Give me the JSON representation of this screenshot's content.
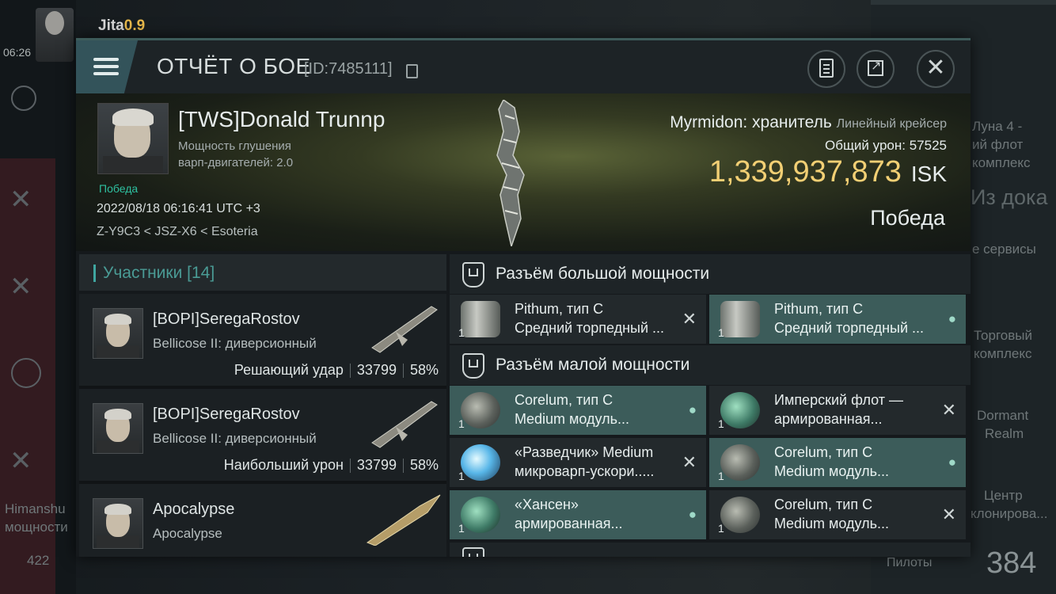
{
  "background": {
    "system": {
      "name": "Jita",
      "security": "0.9"
    },
    "clock": "06:26",
    "left_labels": [
      "Himanshu",
      "мощности"
    ],
    "bottom_count": "422",
    "right_labels": [
      "Луна 4 -",
      "ий флот",
      "комплекс",
      "Из дока",
      "е сервисы",
      "Торговый",
      "комплекс",
      "Dormant",
      "Realm",
      "Центр",
      "клонирова..."
    ],
    "pilots_label": "Пилоты",
    "pilots_count": "384"
  },
  "header": {
    "title": "ОТЧЁТ О БОЕ",
    "report_id": "[ID:7485111]"
  },
  "banner": {
    "pilot_name": "[TWS]Donald Trunnp",
    "pilot_attr_line1": "Мощность глушения",
    "pilot_attr_line2": "варп-двигателей: 2.0",
    "victory_tag": "Победа",
    "datetime": "2022/08/18 06:16:41 UTC +3",
    "route": "Z-Y9C3 < JSZ-X6 < Esoteria",
    "ship_name": "Myrmidon: хранитель",
    "ship_class": "Линейный крейсер",
    "total_damage_label": "Общий урон:",
    "total_damage": "57525",
    "isk_value": "1,339,937,873",
    "isk_unit": "ISK",
    "result": "Победа"
  },
  "participants": {
    "title": "Участники [14]",
    "rows": [
      {
        "name": "[BOPI]SeregaRostov",
        "ship": "Bellicose II: диверсионный",
        "role": "Решающий удар",
        "damage": "33799",
        "percent": "58%"
      },
      {
        "name": "[BOPI]SeregaRostov",
        "ship": "Bellicose II: диверсионный",
        "role": "Наибольший урон",
        "damage": "33799",
        "percent": "58%"
      },
      {
        "name": "Apocalypse",
        "ship": "Apocalypse",
        "role": "",
        "damage": "",
        "percent": ""
      }
    ]
  },
  "fittings": {
    "high_slots": {
      "title": "Разъём большой мощности",
      "items": [
        {
          "line1": "Pithum, тип C",
          "line2": "Средний торпедный ...",
          "qty": "1",
          "status_icon": "close-icon",
          "status_glyph": "✕"
        },
        {
          "line1": "Pithum, тип C",
          "line2": "Средний торпедный ...",
          "qty": "1",
          "status_icon": "person-icon",
          "status_glyph": "●"
        }
      ]
    },
    "low_slots": {
      "title": "Разъём малой мощности",
      "items": [
        {
          "line1": "Corelum, тип C",
          "line2": "Medium модуль...",
          "qty": "1",
          "status_icon": "person-icon",
          "status_glyph": "●"
        },
        {
          "line1": "Имперский флот —",
          "line2": "армированная...",
          "qty": "1",
          "status_icon": "close-icon",
          "status_glyph": "✕"
        },
        {
          "line1": "«Разведчик» Medium",
          "line2": "микроварп-ускори.....",
          "qty": "1",
          "status_icon": "close-icon",
          "status_glyph": "✕"
        },
        {
          "line1": "Corelum, тип C",
          "line2": "Medium модуль...",
          "qty": "1",
          "status_icon": "person-icon",
          "status_glyph": "●"
        },
        {
          "line1": "«Хансен»",
          "line2": "армированная...",
          "qty": "1",
          "status_icon": "person-icon",
          "status_glyph": "●"
        },
        {
          "line1": "Corelum, тип C",
          "line2": "Medium модуль...",
          "qty": "1",
          "status_icon": "close-icon",
          "status_glyph": "✕"
        }
      ]
    }
  },
  "colors": {
    "accent_teal": "#3fa6a0",
    "isk_gold": "#f2cf74",
    "highlight_slot": "#3c5c5a",
    "victory_green": "#2ec0a0"
  }
}
